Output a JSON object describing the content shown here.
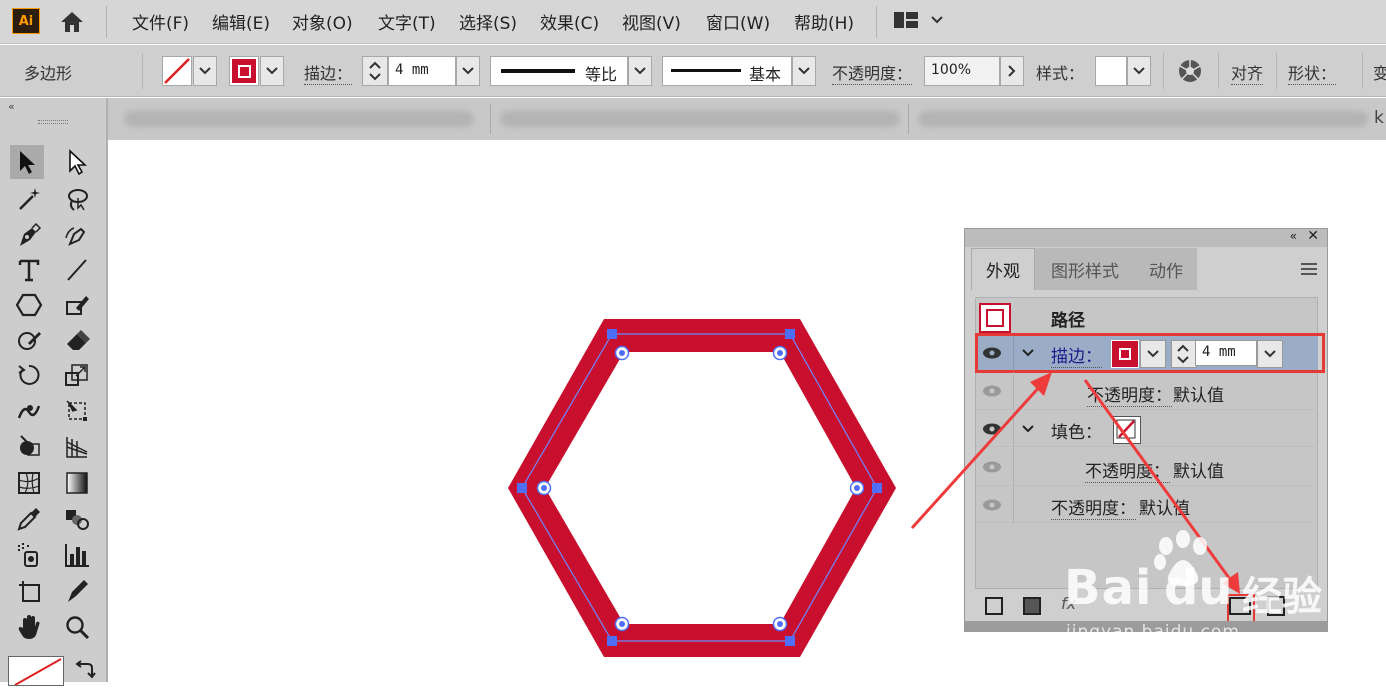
{
  "app": {
    "logo": "Ai"
  },
  "menu": [
    "文件(F)",
    "编辑(E)",
    "对象(O)",
    "文字(T)",
    "选择(S)",
    "效果(C)",
    "视图(V)",
    "窗口(W)",
    "帮助(H)"
  ],
  "control": {
    "object_type": "多边形",
    "stroke_label": "描边：",
    "stroke_value": "4 mm",
    "profile_label": "等比",
    "brush_label": "基本",
    "opacity_label": "不透明度：",
    "opacity_value": "100%",
    "style_label": "样式：",
    "align_label": "对齐",
    "shape_label": "形状：",
    "transform_partial": "变"
  },
  "tab_partial": "k",
  "panel": {
    "tabs": [
      "外观",
      "图形样式",
      "动作"
    ],
    "rows": {
      "path_label": "路径",
      "stroke_label": "描边：",
      "stroke_value": "4 mm",
      "stroke_opacity": "不透明度：",
      "stroke_opacity_value": "默认值",
      "fill_label": "填色：",
      "fill_opacity": "不透明度：",
      "fill_opacity_value": "默认值",
      "opacity": "不透明度：",
      "opacity_value": "默认值"
    },
    "bottom_partial": "fx"
  },
  "watermark": {
    "brand": "Bai",
    "brand2": "du",
    "cn": "经验",
    "url": "jingyan.baidu.com"
  },
  "colors": {
    "stroke": "#c8102e",
    "accent_selection": "#4f6ef7",
    "highlight_box": "#e53935",
    "row_selected": "#9aacc6"
  }
}
